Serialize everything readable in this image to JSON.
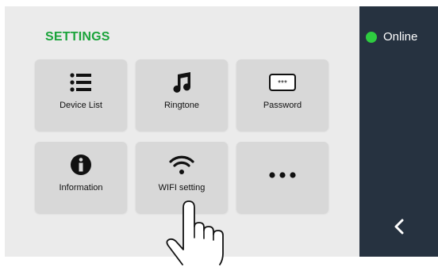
{
  "header": {
    "title": "SETTINGS"
  },
  "tiles": [
    {
      "label": "Device List",
      "icon": "list-icon"
    },
    {
      "label": "Ringtone",
      "icon": "music-note-icon"
    },
    {
      "label": "Password",
      "icon": "password-icon",
      "icon_text": "***"
    },
    {
      "label": "Information",
      "icon": "info-icon"
    },
    {
      "label": "WIFI setting",
      "icon": "wifi-icon"
    },
    {
      "label": "",
      "icon": "more-icon"
    }
  ],
  "status": {
    "text": "Online",
    "indicator_color": "#2ecc40"
  },
  "navigation": {
    "back_icon": "chevron-left-icon"
  },
  "colors": {
    "title": "#1aa33a",
    "sidebar": "#263240",
    "tile": "#d8d8d8",
    "panel": "#ebebeb"
  }
}
